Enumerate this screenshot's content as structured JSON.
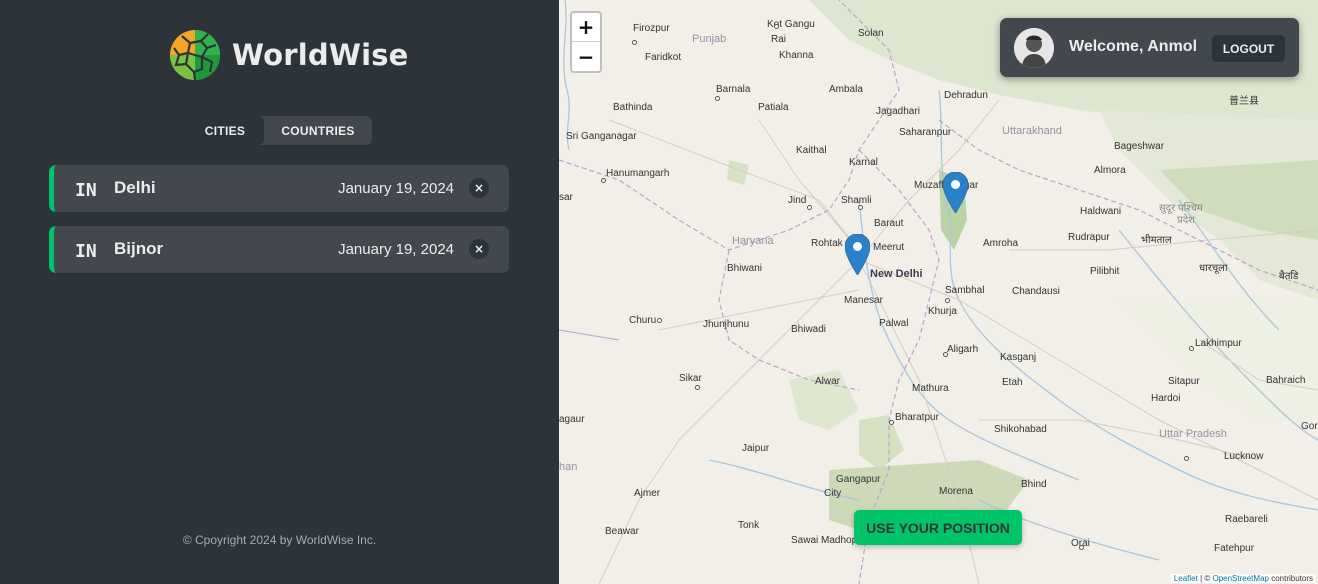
{
  "app": {
    "name": "WorldWise"
  },
  "tabs": [
    {
      "label": "CITIES",
      "active": true
    },
    {
      "label": "COUNTRIES",
      "active": false
    }
  ],
  "cities": [
    {
      "flag": "IN",
      "name": "Delhi",
      "date": "January 19, 2024",
      "delete": "×"
    },
    {
      "flag": "IN",
      "name": "Bijnor",
      "date": "January 19, 2024",
      "delete": "×"
    }
  ],
  "footer": {
    "text": "© Cpoyright 2024 by WorldWise Inc."
  },
  "map": {
    "zoom_in": "+",
    "zoom_out": "−",
    "labels": {
      "kotgangu": "Kot Gangu",
      "firozpur": "Firozpur",
      "raikot": "Rai",
      "solan": "Solan",
      "punjab": "Punjab",
      "faridkot": "Faridkot",
      "khanna": "Khanna",
      "barnala": "Barnala",
      "ambala": "Ambala",
      "dehradun": "Dehradun",
      "bathinda": "Bathinda",
      "patiala": "Patiala",
      "jagadhari": "Jagadhari",
      "sriganganagar": "Sri Ganganagar",
      "saharanpur": "Saharanpur",
      "uttarakhand": "Uttarakhand",
      "bageshwar": "Bageshwar",
      "kaithal": "Kaithal",
      "karnal": "Karnal",
      "hanumangarh": "Hanumangarh",
      "almora": "Almora",
      "muzaffarnagar": "Muzaffarnagar",
      "sar": "sar",
      "jind": "Jind",
      "shamli": "Shamli",
      "haldwani": "Haldwani",
      "baraut": "Baraut",
      "haryana": "Haryana",
      "rohtak": "Rohtak",
      "meerut": "Meerut",
      "amroha": "Amroha",
      "rudrapur": "Rudrapur",
      "bhimtal": "भीमताल",
      "newdelhi": "New Delhi",
      "bhiwani": "Bhiwani",
      "pilibhit": "Pilibhit",
      "dharchula": "धारचूला",
      "manesar": "Manesar",
      "sambhal": "Sambhal",
      "chandausi": "Chandausi",
      "churu": "Churu",
      "jhunjhunu": "Jhunjhunu",
      "bhiwadi": "Bhiwadi",
      "palwal": "Palwal",
      "khurja": "Khurja",
      "lakhimpur": "Lakhimpur",
      "aligarh": "Aligarh",
      "kasganj": "Kasganj",
      "sikar": "Sikar",
      "alwar": "Alwar",
      "etah": "Etah",
      "sitapur": "Sitapur",
      "bahraich": "Bahraich",
      "mathura": "Mathura",
      "hardoi": "Hardoi",
      "gaur": "agaur",
      "bharatpur": "Bharatpur",
      "shikohabad": "Shikohabad",
      "uttarpradesh": "Uttar Pradesh",
      "gon": "Gor",
      "jaipur": "Jaipur",
      "lucknow": "Lucknow",
      "han": "han",
      "gangapur": "Gangapur",
      "gangapur2": "City",
      "bhind": "Bhind",
      "ajmer": "Ajmer",
      "morena": "Morena",
      "raebareli": "Raebareli",
      "tonk": "Tonk",
      "beawar": "Beawar",
      "sawaimadhopur": "Sawai Madhop",
      "orai": "Orai",
      "fatehpur": "Fatehpur",
      "nepali1": "सुदूर पश्चिम",
      "nepali2": "प्रदेश",
      "tibet": "普兰县",
      "baitadi": "बैतडि"
    },
    "attribution": {
      "leaflet": "Leaflet",
      "sep": " | © ",
      "osm": "OpenStreetMap",
      "tail": " contributors"
    }
  },
  "user": {
    "welcome": "Welcome, Anmol",
    "logout": "LOGOUT"
  },
  "actions": {
    "use_position": "USE YOUR POSITION"
  },
  "colors": {
    "accent": "#00c46a",
    "dark": "#2d3439",
    "medium": "#42484d",
    "marker": "#2a81cb"
  }
}
